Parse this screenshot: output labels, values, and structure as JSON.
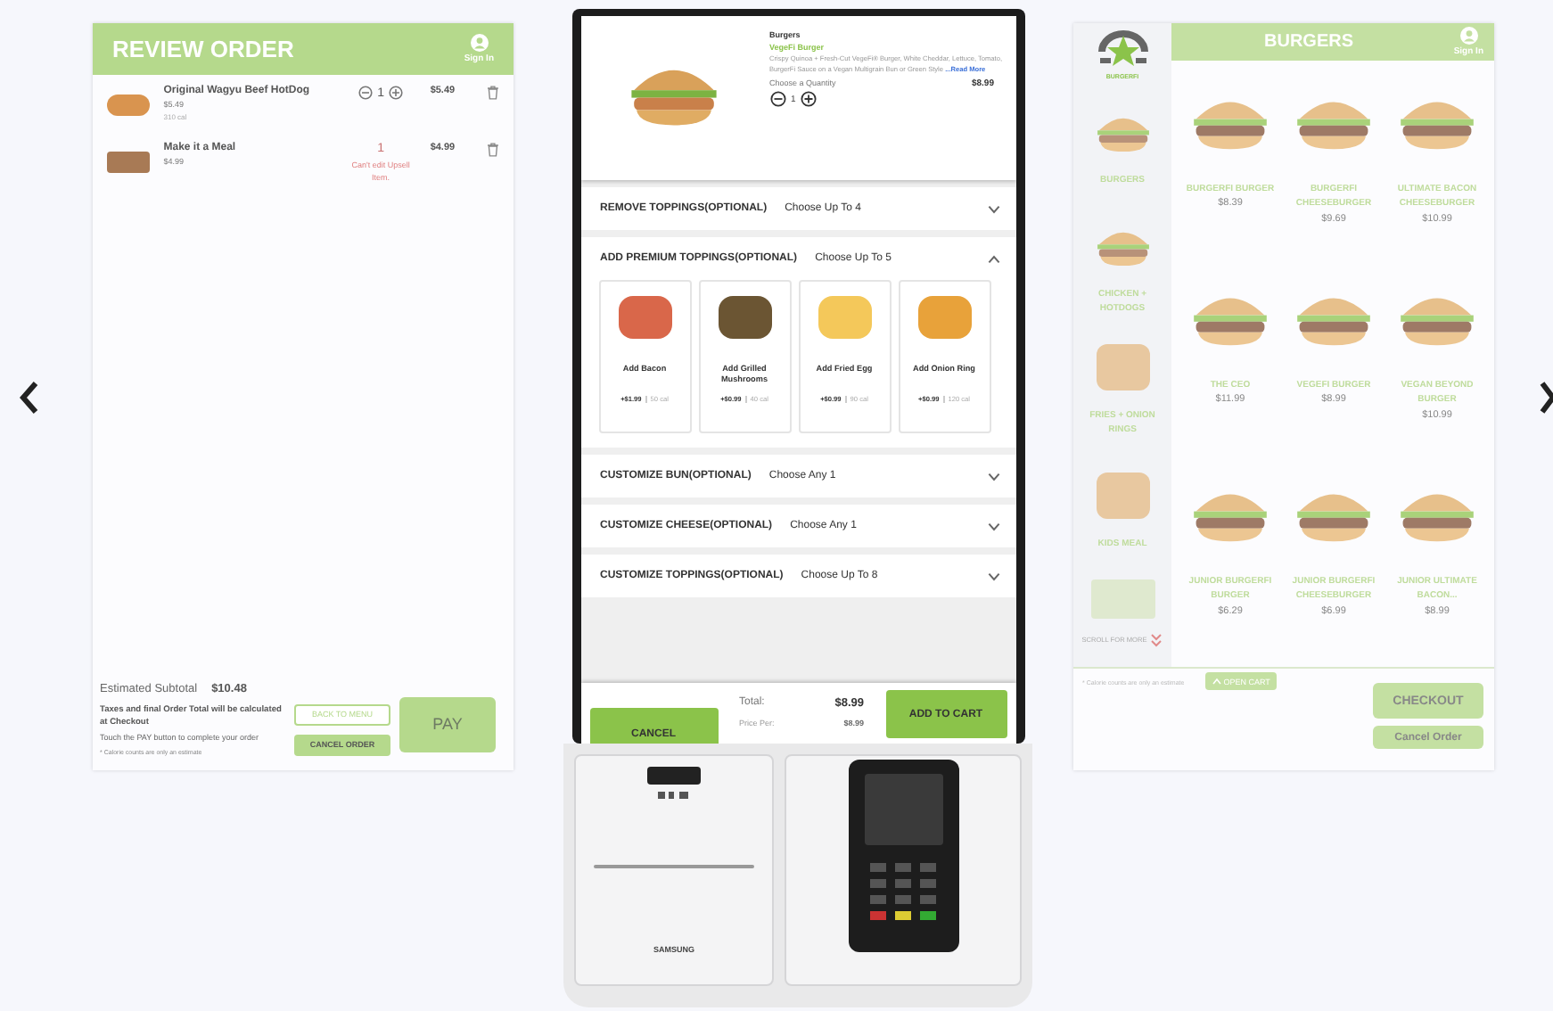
{
  "review_order": {
    "title": "REVIEW ORDER",
    "sign_in": "Sign In",
    "items": [
      {
        "name": "Original Wagyu Beef HotDog",
        "price": "$5.49",
        "calories": "310 cal",
        "quantity": "1",
        "adjustable": true,
        "total": "$5.49"
      },
      {
        "name": "Make it a Meal",
        "price": "$4.99",
        "quantity": "1",
        "adjustable": false,
        "note": "Can't edit Upsell Item.",
        "total": "$4.99"
      }
    ],
    "subtotal_label": "Estimated Subtotal",
    "subtotal": "$10.48",
    "tax_note": "Taxes and final Order Total will be calculated at Checkout",
    "pay_note": "Touch the PAY button to complete your order",
    "calorie_note": "* Calorie counts are only an estimate",
    "back_button": "BACK TO MENU",
    "cancel_button": "CANCEL ORDER",
    "pay_button": "PAY"
  },
  "kiosk": {
    "product": {
      "category": "Burgers",
      "name": "VegeFi Burger",
      "description": "Crispy Quinoa + Fresh-Cut VegeFi® Burger, White Cheddar, Lettuce, Tomato, BurgerFi Sauce on a Vegan Multigrain Bun or Green Style",
      "read_more": "...Read More",
      "quantity_label": "Choose a Quantity",
      "quantity": "1",
      "price": "$8.99"
    },
    "sections": [
      {
        "title": "REMOVE TOPPINGS(OPTIONAL)",
        "rule": "Choose Up To 4",
        "expanded": false
      },
      {
        "title": "ADD PREMIUM TOPPINGS(OPTIONAL)",
        "rule": "Choose Up To 5",
        "expanded": true,
        "options": [
          {
            "name": "Add Bacon",
            "price": "+$1.99",
            "calories": "50 cal"
          },
          {
            "name": "Add Grilled Mushrooms",
            "price": "+$0.99",
            "calories": "40 cal"
          },
          {
            "name": "Add Fried Egg",
            "price": "+$0.99",
            "calories": "90 cal"
          },
          {
            "name": "Add Onion Ring",
            "price": "+$0.99",
            "calories": "120 cal"
          }
        ]
      },
      {
        "title": "CUSTOMIZE BUN(OPTIONAL)",
        "rule": "Choose Any 1",
        "expanded": false
      },
      {
        "title": "CUSTOMIZE CHEESE(OPTIONAL)",
        "rule": "Choose Any 1",
        "expanded": false
      },
      {
        "title": "CUSTOMIZE TOPPINGS(OPTIONAL)",
        "rule": "Choose Up To 8",
        "expanded": false
      }
    ],
    "footer": {
      "cancel": "CANCEL",
      "total_label": "Total:",
      "total": "$8.99",
      "price_per_label": "Price Per:",
      "price_per": "$8.99",
      "add": "ADD TO CART"
    },
    "brand": "SAMSUNG"
  },
  "menu": {
    "logo_text": "BURGERFI",
    "title": "BURGERS",
    "sign_in": "Sign In",
    "categories": [
      {
        "name": "BURGERS",
        "kind": "burger"
      },
      {
        "name": "CHICKEN + HOTDOGS",
        "kind": "burger"
      },
      {
        "name": "FRIES + ONION RINGS",
        "kind": "sides"
      },
      {
        "name": "KIDS MEAL",
        "kind": "sides"
      }
    ],
    "scroll_hint": "SCROLL FOR MORE",
    "items": [
      {
        "name": "BURGERFI BURGER",
        "price": "$8.39"
      },
      {
        "name": "BURGERFI CHEESEBURGER",
        "price": "$9.69"
      },
      {
        "name": "ULTIMATE BACON CHEESEBURGER",
        "price": "$10.99"
      },
      {
        "name": "THE CEO",
        "price": "$11.99"
      },
      {
        "name": "VEGEFI BURGER",
        "price": "$8.99"
      },
      {
        "name": "VEGAN BEYOND BURGER",
        "price": "$10.99"
      },
      {
        "name": "JUNIOR BURGERFI BURGER",
        "price": "$6.29"
      },
      {
        "name": "JUNIOR BURGERFI CHEESEBURGER",
        "price": "$6.99"
      },
      {
        "name": "JUNIOR ULTIMATE BACON...",
        "price": "$8.99"
      }
    ],
    "calorie_note": "* Calorie counts are only an estimate",
    "open_cart": "OPEN CART",
    "checkout": "CHECKOUT",
    "cancel": "Cancel Order"
  }
}
